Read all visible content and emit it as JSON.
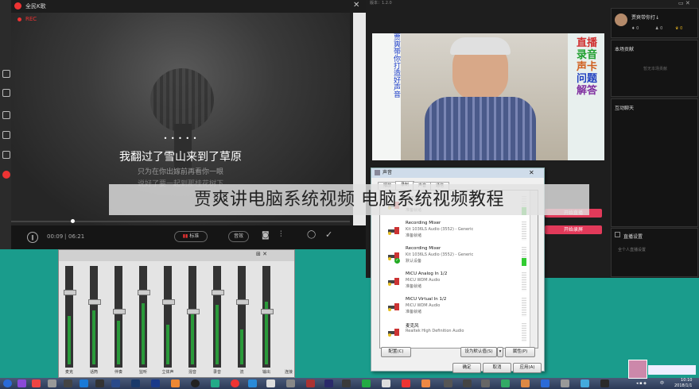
{
  "karaoke": {
    "title": "全民K歌",
    "rec": "REC",
    "lyric_main": "我翻过了雪山来到了草原",
    "lyric_sub1": "只为在你出嫁前再看你一眼",
    "lyric_sub2": "说好了要一起到那桂花树下",
    "dots": "• • • • •",
    "time_current": "00:09",
    "time_total": "06:21",
    "sep": "|",
    "btn_tone": "标准",
    "btn_mode": "音效",
    "icons": [
      "pause-icon",
      "camera-icon",
      "equalizer-icon",
      "loop-icon",
      "check-icon"
    ]
  },
  "stream": {
    "version": "版本：1.2.0",
    "host_name": "贾爽带你打↓",
    "stat1": "0",
    "stat2": "0",
    "stat3": "0",
    "contrib_title": "本场贡献",
    "contrib_sub": "暂无本场贡献",
    "chat_title": "互动聊天",
    "btn_start_live": "开始直播",
    "btn_start_record": "开始录屏",
    "settings_label": "直播设置",
    "settings_sub": "全个人直播设置",
    "poster_left": "贾爽带你打造好声音",
    "poster_right_1": "直播",
    "poster_right_2": "录音",
    "poster_right_3": "声卡",
    "poster_right_4": "问题",
    "poster_right_5": "解答"
  },
  "mixer": {
    "channels": [
      "麦克",
      "话筒",
      "伴奏",
      "监听",
      "立体声",
      "混音",
      "录音",
      "流",
      "输出"
    ],
    "bottom_label": "连接",
    "levels": [
      0.55,
      0.62,
      0.5,
      0.7,
      0.45,
      0.6,
      0.68,
      0.4,
      0.72
    ]
  },
  "dialog": {
    "title": "声音",
    "tabs": [
      "播放",
      "录制",
      "声音",
      "通信"
    ],
    "devices": [
      {
        "name": "麦克风",
        "desc": "HD Pro Webcam C920",
        "status": "准备就绪"
      },
      {
        "name": "Recording Mixer",
        "desc": "Kit 1036LS Audio (3552) - Generic",
        "status": "准备就绪"
      },
      {
        "name": "Recording Mixer",
        "desc": "Kit 1036LS Audio (3552) - Generic",
        "status": "默认设备"
      },
      {
        "name": "MiCU Analog In 1/2",
        "desc": "MiCU WDM Audio",
        "status": "准备就绪"
      },
      {
        "name": "MiCU Virtual In 1/2",
        "desc": "MiCU WDM Audio",
        "status": "准备就绪"
      },
      {
        "name": "麦克风",
        "desc": "Realtek High Definition Audio",
        "status": ""
      }
    ],
    "btn_configure": "配置(C)",
    "btn_set_default": "设为默认值(S)",
    "btn_properties": "属性(P)",
    "btn_ok": "确定",
    "btn_cancel": "取消",
    "btn_apply": "应用(A)"
  },
  "banner": "贾爽讲电脑系统视频 电脑系统视频教程",
  "taskbar": {
    "time": "10:10",
    "date": "2018/1/1",
    "lang": "中"
  },
  "colors": {
    "desktop": "#1a9c8c",
    "accent_pink": "#e23a5a",
    "meter_green": "#2a9a3a"
  }
}
